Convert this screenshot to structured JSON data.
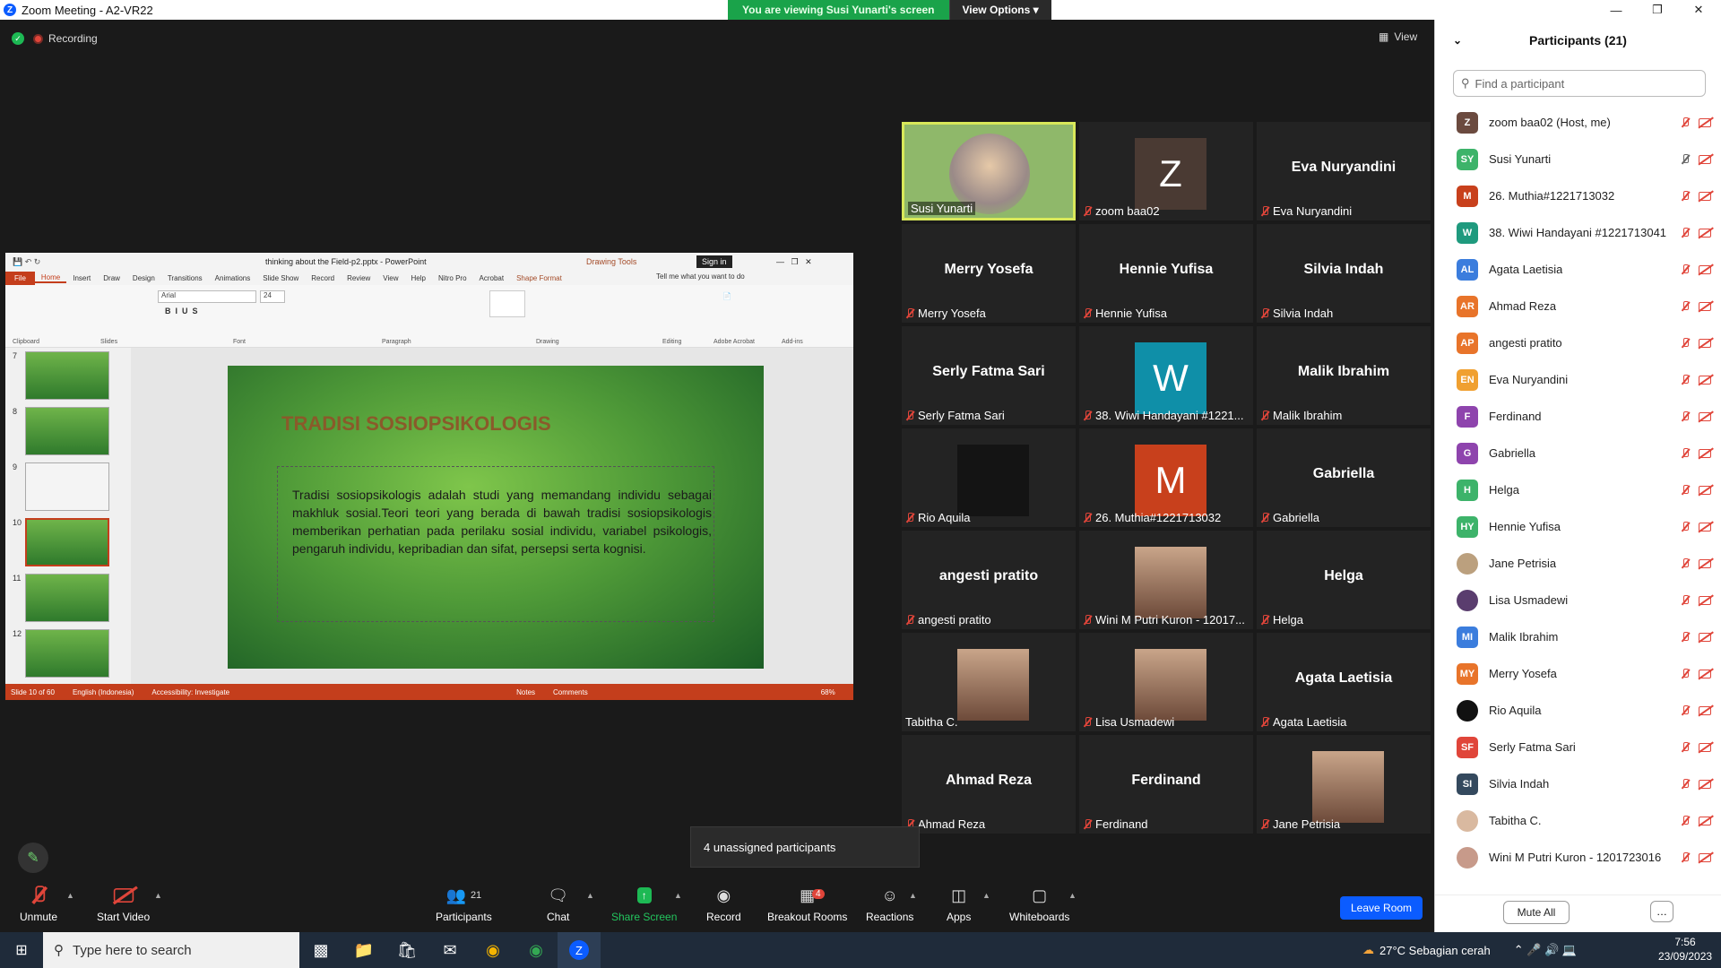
{
  "window": {
    "title": "Zoom Meeting - A2-VR22"
  },
  "banner": {
    "viewing_text": "You are viewing Susi Yunarti's screen",
    "options_label": "View Options"
  },
  "meeting": {
    "recording_label": "Recording",
    "view_label": "View"
  },
  "powerpoint": {
    "doc_title": "thinking about the Field-p2.pptx  -  PowerPoint",
    "drawing_tools": "Drawing Tools",
    "sign_in": "Sign in",
    "tabs": [
      "File",
      "Home",
      "Insert",
      "Draw",
      "Design",
      "Transitions",
      "Animations",
      "Slide Show",
      "Record",
      "Review",
      "View",
      "Help",
      "Nitro Pro",
      "Acrobat",
      "Shape Format"
    ],
    "tell_me": "Tell me what you want to do",
    "font_name": "Arial",
    "font_size": "24",
    "groups": [
      "Clipboard",
      "Slides",
      "Font",
      "Paragraph",
      "Drawing",
      "Editing",
      "Adobe Acrobat",
      "Add-ins"
    ],
    "thumb_numbers": [
      "7",
      "8",
      "9",
      "10",
      "11",
      "12"
    ],
    "slide_title": "TRADISI SOSIOPSIKOLOGIS",
    "slide_body": "Tradisi sosiopsikologis adalah studi yang memandang individu sebagai makhluk sosial.Teori teori yang berada di bawah tradisi sosiopsikologis memberikan perhatian pada perilaku sosial individu, variabel psikologis, pengaruh individu, kepribadian dan sifat, persepsi serta kognisi.",
    "status": {
      "slide": "Slide 10 of 60",
      "lang": "English (Indonesia)",
      "access": "Accessibility: Investigate",
      "notes": "Notes",
      "comments": "Comments",
      "zoom": "68%"
    }
  },
  "gallery": [
    {
      "name": "Susi Yunarti",
      "type": "photo",
      "muted": false
    },
    {
      "name": "zoom baa02",
      "type": "avatar",
      "letter": "Z",
      "color": "#4a3a33",
      "muted": true
    },
    {
      "name": "Eva Nuryandini",
      "type": "text",
      "muted": true
    },
    {
      "name": "Merry Yosefa",
      "type": "text",
      "muted": true
    },
    {
      "name": "Hennie Yufisa",
      "type": "text",
      "muted": true
    },
    {
      "name": "Silvia Indah",
      "type": "text",
      "muted": true
    },
    {
      "name": "Serly Fatma Sari",
      "type": "text",
      "muted": true
    },
    {
      "name": "38. Wiwi Handayani #1221...",
      "type": "avatar",
      "letter": "W",
      "color": "#0f8fa8",
      "muted": true
    },
    {
      "name": "Malik Ibrahim",
      "type": "text",
      "muted": true
    },
    {
      "name": "Rio Aquila",
      "type": "avatar",
      "letter": "",
      "color": "#141414",
      "muted": true
    },
    {
      "name": "26. Muthia#1221713032",
      "type": "avatar",
      "letter": "M",
      "color": "#c8401c",
      "muted": true
    },
    {
      "name": "Gabriella",
      "type": "text",
      "muted": true
    },
    {
      "name": "angesti pratito",
      "type": "text",
      "muted": true
    },
    {
      "name": "Wini M Putri Kuron - 12017...",
      "type": "photo",
      "muted": true
    },
    {
      "name": "Helga",
      "type": "text",
      "muted": true
    },
    {
      "name": "Tabitha C.",
      "type": "photo",
      "muted": false
    },
    {
      "name": "Lisa Usmadewi",
      "type": "photo",
      "muted": true
    },
    {
      "name": "Agata Laetisia",
      "type": "text",
      "muted": true
    },
    {
      "name": "Ahmad Reza",
      "type": "text",
      "muted": true
    },
    {
      "name": "Ferdinand",
      "type": "text",
      "muted": true
    },
    {
      "name": "Jane Petrisia",
      "type": "photo",
      "muted": true
    }
  ],
  "panel": {
    "title": "Participants (21)",
    "search_placeholder": "Find a participant",
    "participants": [
      {
        "initials": "Z",
        "name": "zoom baa02 (Host, me)",
        "color": "#6b4a3f"
      },
      {
        "initials": "SY",
        "name": "Susi Yunarti",
        "color": "#3db36a"
      },
      {
        "initials": "M",
        "name": "26. Muthia#1221713032",
        "color": "#c8401c"
      },
      {
        "initials": "W",
        "name": "38. Wiwi Handayani #1221713041",
        "color": "#1f9a7e"
      },
      {
        "initials": "AL",
        "name": "Agata Laetisia",
        "color": "#3b7ddd"
      },
      {
        "initials": "AR",
        "name": "Ahmad Reza",
        "color": "#e8742a"
      },
      {
        "initials": "AP",
        "name": "angesti pratito",
        "color": "#e8742a"
      },
      {
        "initials": "EN",
        "name": "Eva Nuryandini",
        "color": "#f0a030"
      },
      {
        "initials": "F",
        "name": "Ferdinand",
        "color": "#8e44ad"
      },
      {
        "initials": "G",
        "name": "Gabriella",
        "color": "#8e44ad"
      },
      {
        "initials": "H",
        "name": "Helga",
        "color": "#3db36a"
      },
      {
        "initials": "HY",
        "name": "Hennie Yufisa",
        "color": "#3db36a"
      },
      {
        "initials": "",
        "name": "Jane Petrisia",
        "color": "#bba07e"
      },
      {
        "initials": "",
        "name": "Lisa Usmadewi",
        "color": "#5a3d6e"
      },
      {
        "initials": "MI",
        "name": "Malik Ibrahim",
        "color": "#3b7ddd"
      },
      {
        "initials": "MY",
        "name": "Merry Yosefa",
        "color": "#e8742a"
      },
      {
        "initials": "",
        "name": "Rio Aquila",
        "color": "#111111"
      },
      {
        "initials": "SF",
        "name": "Serly Fatma Sari",
        "color": "#e0453a"
      },
      {
        "initials": "SI",
        "name": "Silvia Indah",
        "color": "#34495e"
      },
      {
        "initials": "",
        "name": "Tabitha C.",
        "color": "#d9b9a0"
      },
      {
        "initials": "",
        "name": "Wini M Putri Kuron - 1201723016",
        "color": "#c79a8a"
      }
    ],
    "mute_all": "Mute All",
    "more": "…"
  },
  "popup": {
    "unassigned": "4 unassigned participants"
  },
  "toolbar": {
    "unmute": "Unmute",
    "start_video": "Start Video",
    "participants": "Participants",
    "participants_count": "21",
    "chat": "Chat",
    "share": "Share Screen",
    "record": "Record",
    "breakout": "Breakout Rooms",
    "breakout_count": "4",
    "reactions": "Reactions",
    "apps": "Apps",
    "whiteboards": "Whiteboards",
    "leave": "Leave Room"
  },
  "taskbar": {
    "search_placeholder": "Type here to search",
    "weather": "27°C  Sebagian cerah",
    "time": "7:56",
    "date": "23/09/2023"
  }
}
